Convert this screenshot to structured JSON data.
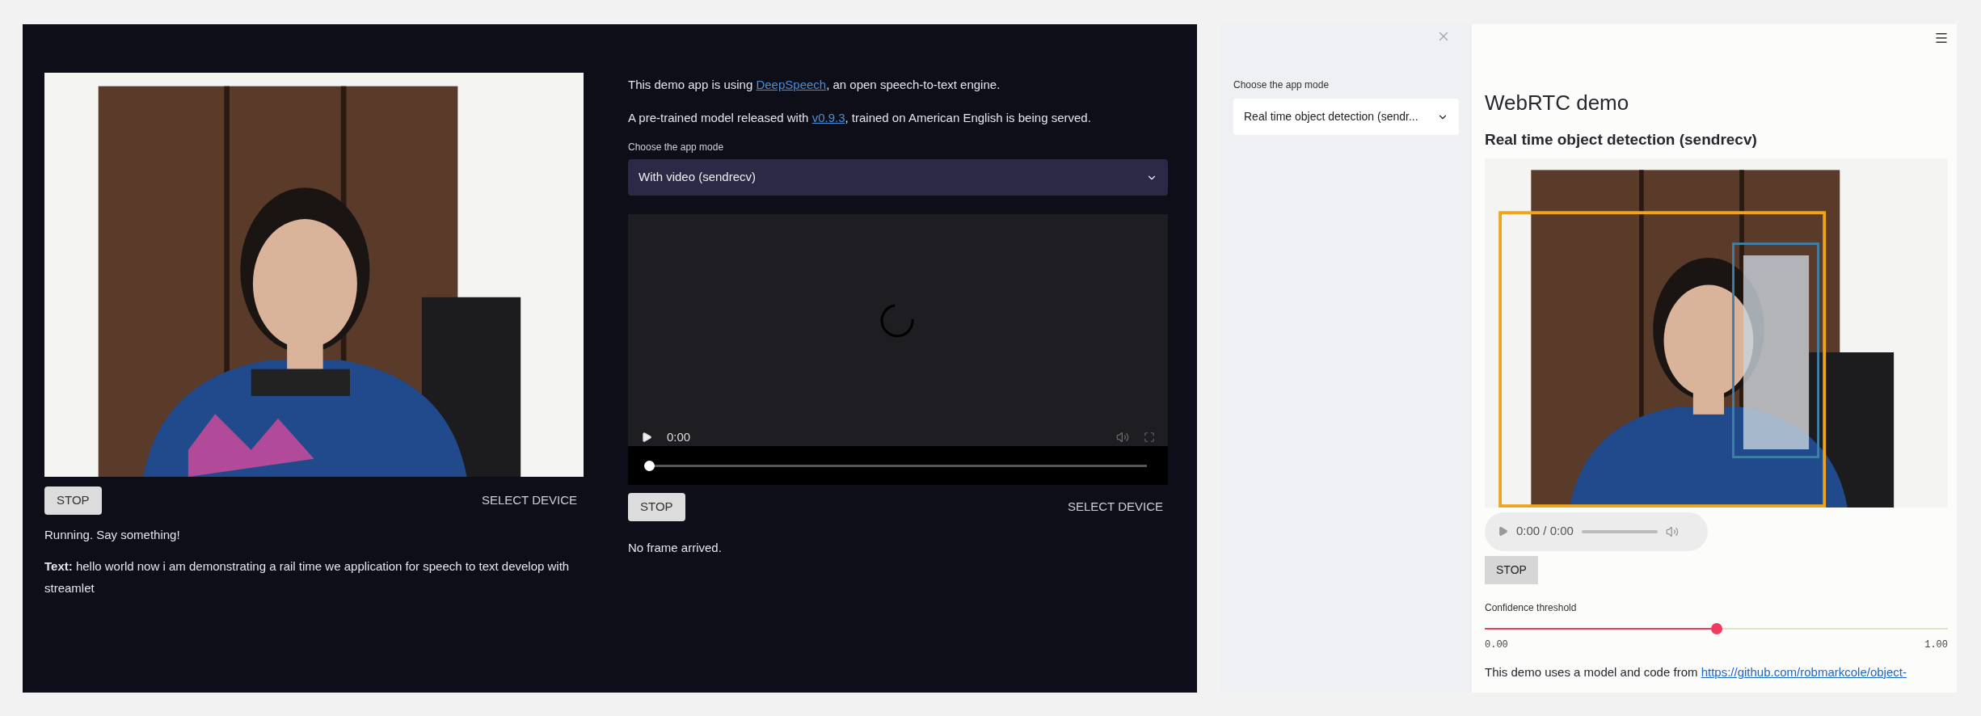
{
  "speech_app": {
    "webcam": {
      "stop_button": "STOP",
      "select_device": "SELECT DEVICE"
    },
    "status": "Running. Say something!",
    "transcript": "**Text:** hello world now i am demonstrating a rail time we application for speech to text develop with streamlet",
    "intro": [
      {
        "before": "This demo app is using ",
        "link": "DeepSpeech",
        "after": ", an open speech-to-text engine."
      },
      {
        "before": "A pre-trained model released with ",
        "link": "v0.9.3",
        "after": ", trained on American English is being served."
      }
    ],
    "mode_select": {
      "label": "Choose the app mode",
      "value": "With video (sendrecv)"
    },
    "player": {
      "time": "0:00",
      "level": 0
    },
    "stream": {
      "stop_button": "STOP",
      "select_device": "SELECT DEVICE"
    },
    "message": "No frame arrived."
  },
  "webrtc_app": {
    "sidebar": {
      "label": "Choose the app mode",
      "value": "Real time object detection (sendr..."
    },
    "title": "WebRTC demo",
    "subheading": "Real time object detection (sendrecv)",
    "audio": {
      "time": "0:00 / 0:00"
    },
    "stop_button": "STOP",
    "slider": {
      "label": "Confidence threshold",
      "level": 0.5,
      "min": "0.00",
      "max": "1.00"
    },
    "footer": {
      "before": "This demo uses a model and code from ",
      "link": "https://github.com/robmarkcole/object-"
    }
  }
}
